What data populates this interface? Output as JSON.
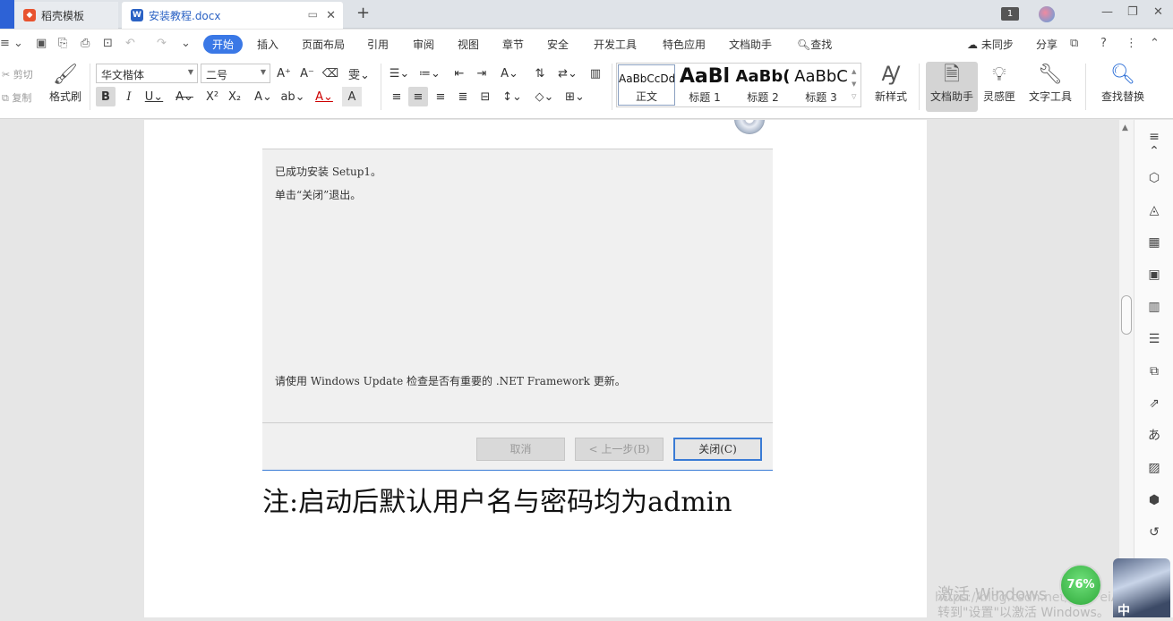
{
  "titlebar": {
    "tabs": [
      {
        "label": "稻壳模板",
        "icon": "docer-logo-icon"
      },
      {
        "label": "安装教程.docx",
        "icon": "word-doc-icon"
      }
    ],
    "badge": "1"
  },
  "menubar": {
    "items": [
      "开始",
      "插入",
      "页面布局",
      "引用",
      "审阅",
      "视图",
      "章节",
      "安全",
      "开发工具",
      "特色应用",
      "文档助手"
    ],
    "search_label": "查找",
    "sync_label": "未同步",
    "share_label": "分享"
  },
  "ribbon": {
    "cut": "剪切",
    "copy": "复制",
    "format_painter": "格式刷",
    "font_name": "华文楷体",
    "font_size": "二号",
    "styles": [
      {
        "sample": "AaBbCcDd",
        "name": "正文"
      },
      {
        "sample": "AaBl",
        "name": "标题 1"
      },
      {
        "sample": "AaBb(",
        "name": "标题 2"
      },
      {
        "sample": "AaBbC",
        "name": "标题 3"
      }
    ],
    "new_style": "新样式",
    "doc_assistant": "文档助手",
    "inspiration": "灵感匣",
    "text_tools": "文字工具",
    "find_replace": "查找替换"
  },
  "document": {
    "dialog": {
      "line1": "已成功安装 Setup1。",
      "line2": "单击“关闭”退出。",
      "line3": "请使用 Windows Update 检查是否有重要的 .NET Framework 更新。",
      "cancel": "取消",
      "back": "< 上一步(B)",
      "close": "关闭(C)"
    },
    "note": "注:启动后默认用户名与密码均为admin"
  },
  "overlay": {
    "percent": "76%",
    "watermark_line1": "激活 Windows",
    "watermark_line2": "转到\"设置\"以激活 Windows。",
    "watermark_url": "https://blog.csdn.net/DesPeiAdo888",
    "ime": "中"
  }
}
